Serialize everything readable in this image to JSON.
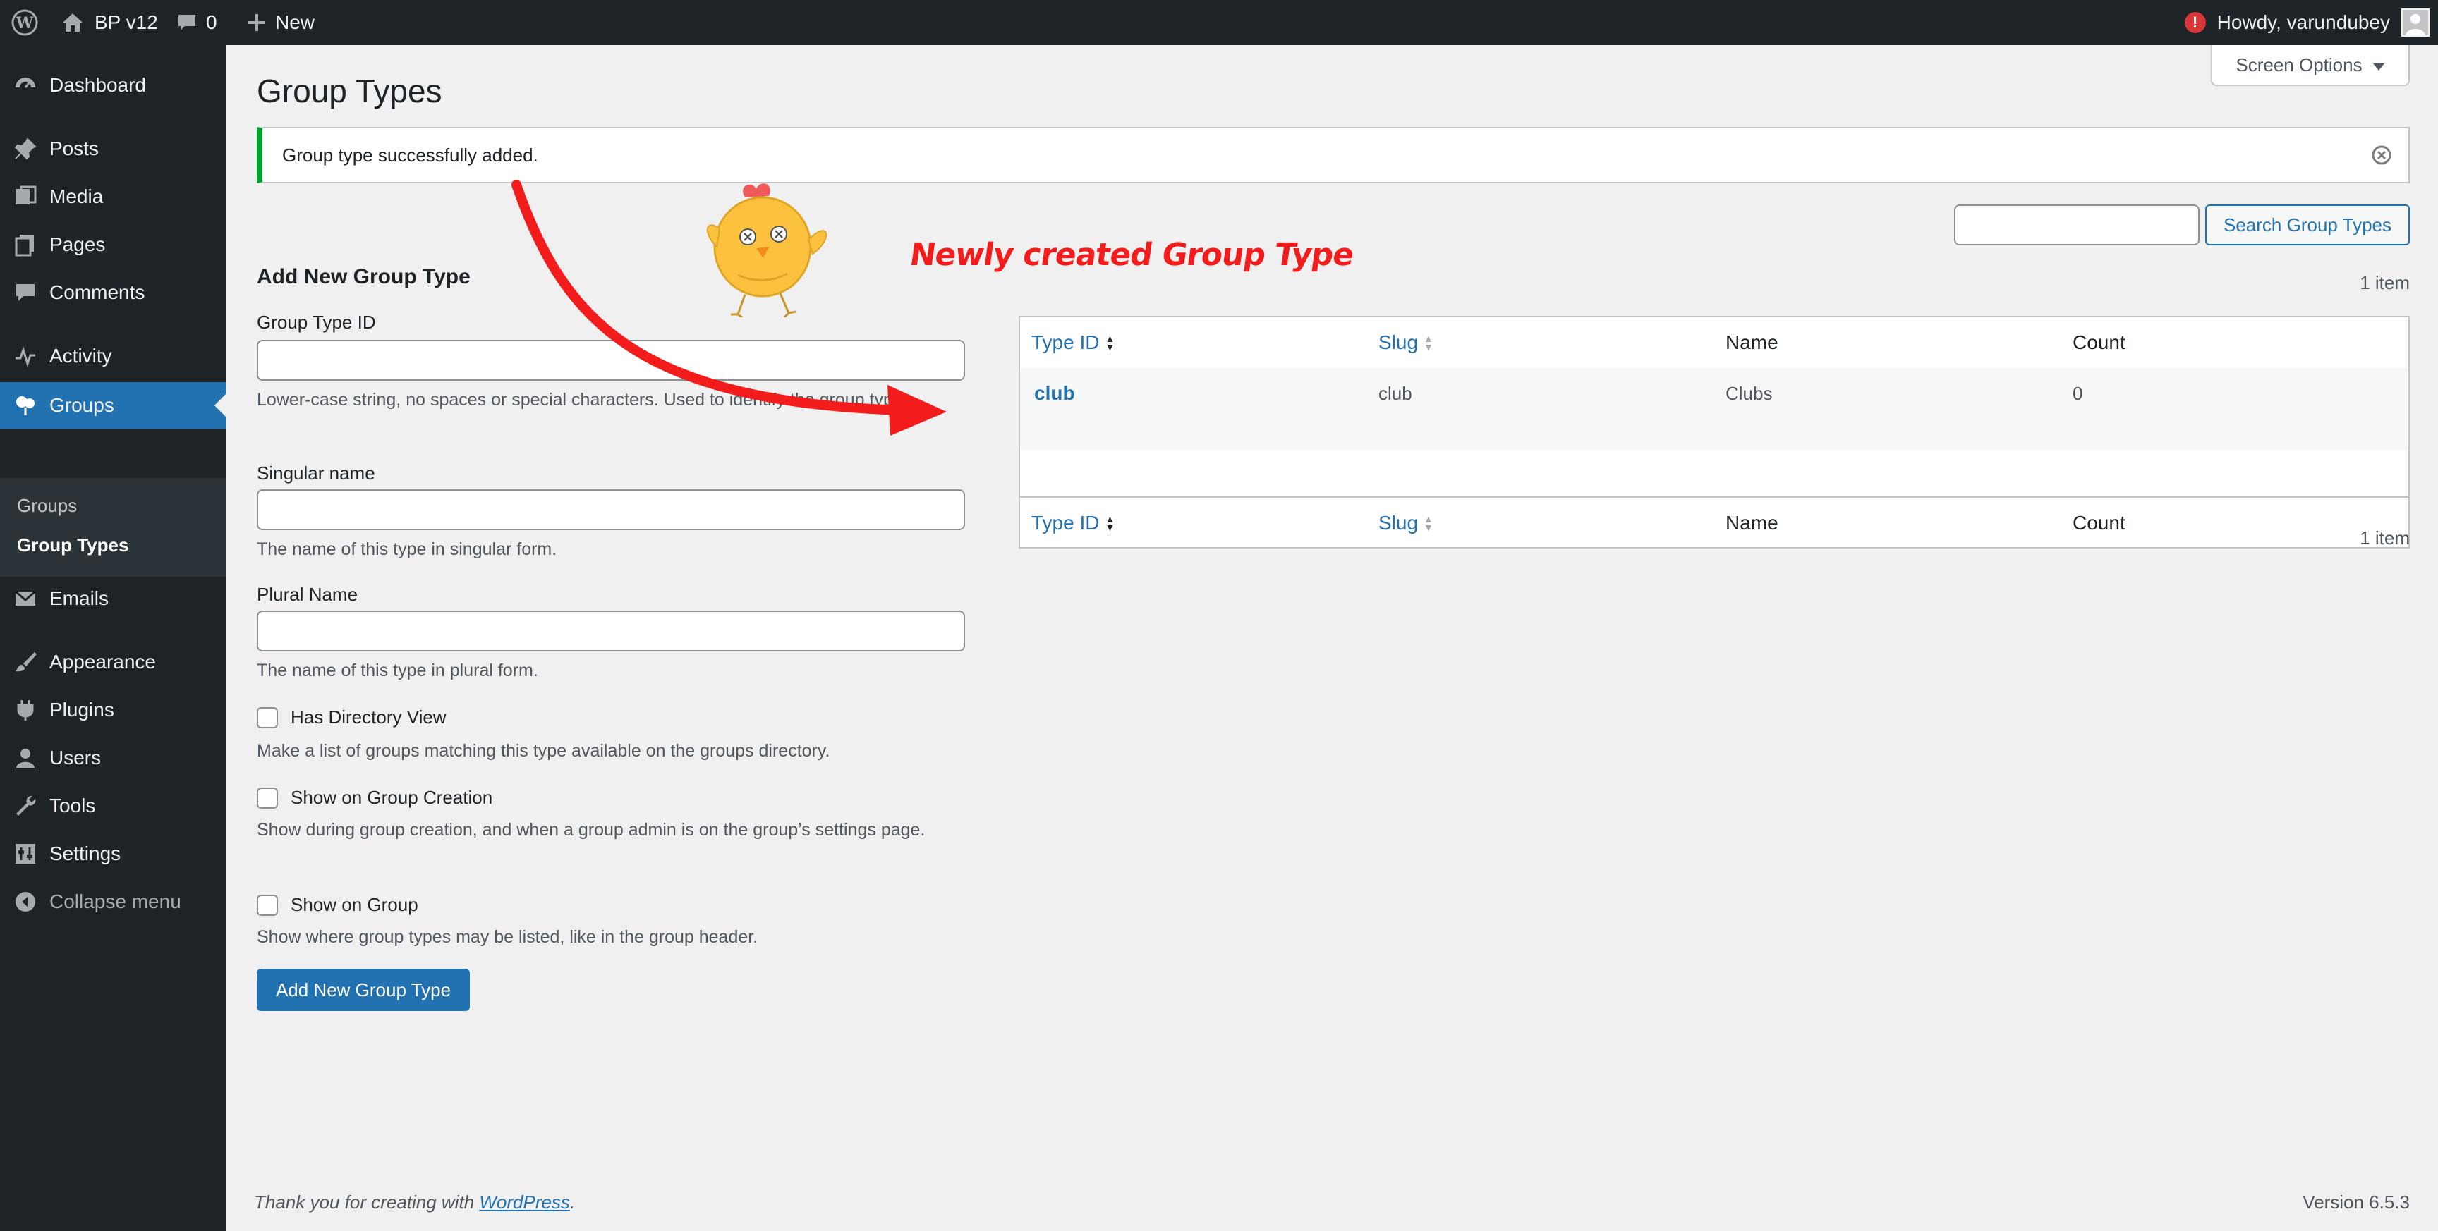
{
  "admin_bar": {
    "site_name": "BP v12",
    "comments_count": "0",
    "new_label": "New",
    "howdy": "Howdy, varundubey",
    "alert_symbol": "!"
  },
  "sidebar": {
    "items": [
      {
        "label": "Dashboard",
        "icon": "dashboard-icon"
      },
      {
        "label": "Posts",
        "icon": "pin-icon"
      },
      {
        "label": "Media",
        "icon": "media-icon"
      },
      {
        "label": "Pages",
        "icon": "pages-icon"
      },
      {
        "label": "Comments",
        "icon": "comment-icon"
      },
      {
        "label": "Activity",
        "icon": "activity-icon"
      },
      {
        "label": "Groups",
        "icon": "groups-icon"
      },
      {
        "label": "Emails",
        "icon": "mail-icon"
      },
      {
        "label": "Appearance",
        "icon": "brush-icon"
      },
      {
        "label": "Plugins",
        "icon": "plugin-icon"
      },
      {
        "label": "Users",
        "icon": "user-icon"
      },
      {
        "label": "Tools",
        "icon": "wrench-icon"
      },
      {
        "label": "Settings",
        "icon": "settings-icon"
      }
    ],
    "submenu": [
      {
        "label": "Groups"
      },
      {
        "label": "Group Types"
      }
    ],
    "collapse_label": "Collapse menu"
  },
  "page": {
    "title": "Group Types",
    "screen_options": "Screen Options",
    "notice": "Group type successfully added."
  },
  "form": {
    "heading": "Add New Group Type",
    "type_id_label": "Group Type ID",
    "type_id_desc": "Lower-case string, no spaces or special characters. Used to identify the group type.",
    "singular_label": "Singular name",
    "singular_desc": "The name of this type in singular form.",
    "plural_label": "Plural Name",
    "plural_desc": "The name of this type in plural form.",
    "has_directory_label": "Has Directory View",
    "has_directory_desc": "Make a list of groups matching this type available on the groups directory.",
    "show_creation_label": "Show on Group Creation",
    "show_creation_desc": "Show during group creation, and when a group admin is on the group’s settings page.",
    "show_group_label": "Show on Group",
    "show_group_desc": "Show where group types may be listed, like in the group header.",
    "submit_label": "Add New Group Type"
  },
  "list": {
    "search_button": "Search Group Types",
    "items_count": "1 item",
    "columns": [
      "Type ID",
      "Slug",
      "Name",
      "Count"
    ],
    "rows": [
      {
        "type_id": "club",
        "slug": "club",
        "name": "Clubs",
        "count": "0"
      }
    ]
  },
  "annotation": {
    "text": "Newly created Group Type",
    "color": "#f21c1c"
  },
  "footer": {
    "thanks_prefix": "Thank you for creating with ",
    "thanks_link": "WordPress",
    "thanks_suffix": ".",
    "version": "Version 6.5.3"
  },
  "colors": {
    "admin_dark": "#1d2327",
    "accent": "#2271b1",
    "success": "#00a32a",
    "background": "#f0f0f1"
  }
}
